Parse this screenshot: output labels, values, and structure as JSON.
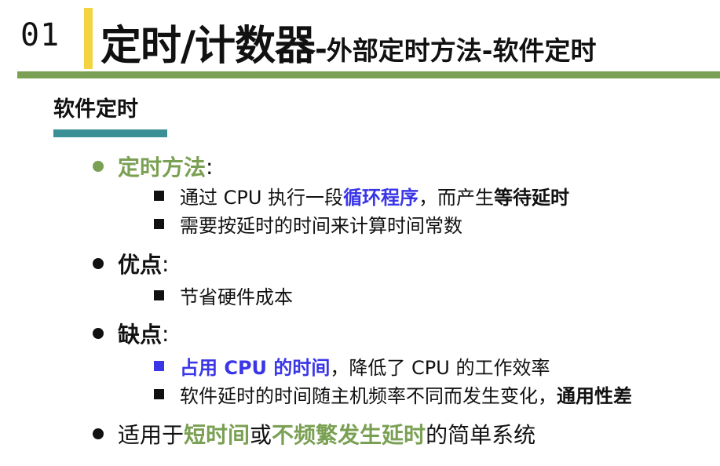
{
  "header": {
    "number": "01",
    "title": "定时/计数器",
    "dash": "-",
    "subtitle": "外部定时方法-软件定时"
  },
  "section": {
    "title": "软件定时"
  },
  "method": {
    "label": "定时方法",
    "colon": ":",
    "line1_prefix": "通过 CPU 执行一段",
    "line1_highlight": "循环程序",
    "line1_middle": "，而产生",
    "line1_bold": "等待延时",
    "line2": "需要按延时的时间来计算时间常数"
  },
  "advantage": {
    "label": "优点",
    "colon": ":",
    "line1": "节省硬件成本"
  },
  "disadvantage": {
    "label": "缺点",
    "colon": ":",
    "line1_highlight": "占用 CPU 的时间",
    "line1_rest": "，降低了 CPU 的工作效率",
    "line2_prefix": "软件延时的时间随主机频率不同而发生变化，",
    "line2_bold": "通用性差"
  },
  "usage": {
    "prefix": "适用于",
    "highlight1": "短时间",
    "middle": "或",
    "highlight2": "不频繁发生延时",
    "suffix": "的简单系统"
  },
  "colors": {
    "green": "#7aa053",
    "blue": "#3a36e8",
    "yellow": "#f3d33f",
    "teal": "#3b9096"
  }
}
